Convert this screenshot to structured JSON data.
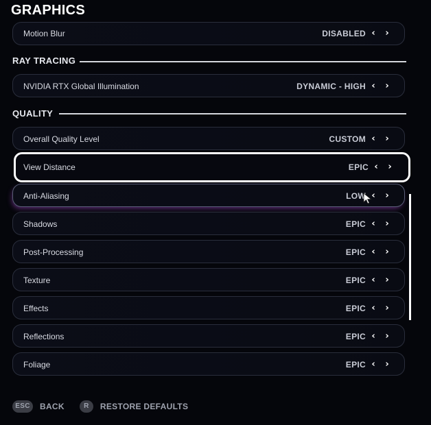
{
  "page_title": "GRAPHICS",
  "rows_top": {
    "motion_blur": {
      "label": "Motion Blur",
      "value": "DISABLED"
    }
  },
  "sections": {
    "ray_tracing": "RAY TRACING",
    "quality": "QUALITY"
  },
  "ray_tracing_rows": {
    "gi": {
      "label": "NVIDIA RTX Global Illumination",
      "value": "DYNAMIC - HIGH"
    }
  },
  "quality_rows": {
    "overall": {
      "label": "Overall Quality Level",
      "value": "CUSTOM"
    },
    "view_distance": {
      "label": "View Distance",
      "value": "EPIC"
    },
    "anti_aliasing": {
      "label": "Anti-Aliasing",
      "value": "LOW"
    },
    "shadows": {
      "label": "Shadows",
      "value": "EPIC"
    },
    "post_processing": {
      "label": "Post-Processing",
      "value": "EPIC"
    },
    "texture": {
      "label": "Texture",
      "value": "EPIC"
    },
    "effects": {
      "label": "Effects",
      "value": "EPIC"
    },
    "reflections": {
      "label": "Reflections",
      "value": "EPIC"
    },
    "foliage": {
      "label": "Foliage",
      "value": "EPIC"
    }
  },
  "arrows": {
    "prev": "‹",
    "next": "›"
  },
  "footer": {
    "esc_key": "ESC",
    "back_label": "BACK",
    "r_key": "R",
    "restore_label": "RESTORE DEFAULTS"
  },
  "colors": {
    "background": "#05060b",
    "selected_border": "#ffffff",
    "row_border": "#2a2e3c",
    "hover_glow": "#5b2a73"
  },
  "icons": {
    "prev": "chevron-left-icon",
    "next": "chevron-right-icon",
    "cursor": "mouse-pointer-icon"
  }
}
